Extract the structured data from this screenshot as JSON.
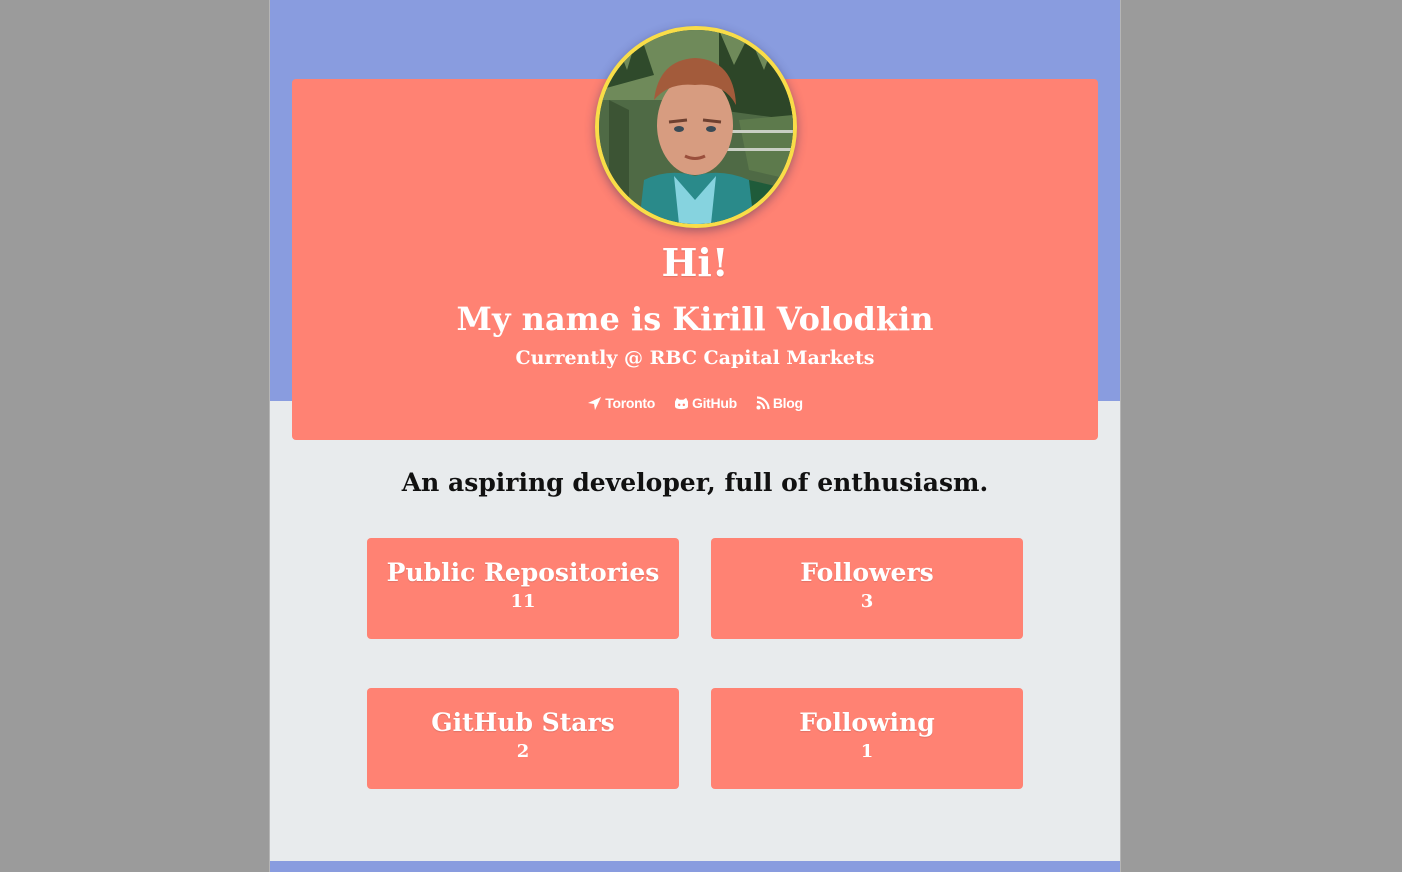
{
  "profile": {
    "greeting": "Hi!",
    "name_line": "My name is Kirill Volodkin",
    "subtitle": "Currently @ RBC Capital Markets",
    "avatar_icon": "profile-photo"
  },
  "links": [
    {
      "label": "Toronto",
      "icon": "location-arrow-icon"
    },
    {
      "label": "GitHub",
      "icon": "github-icon"
    },
    {
      "label": "Blog",
      "icon": "rss-icon"
    }
  ],
  "tagline": "An aspiring developer, full of enthusiasm.",
  "stats": [
    {
      "label": "Public Repositories",
      "value": "11"
    },
    {
      "label": "Followers",
      "value": "3"
    },
    {
      "label": "GitHub Stars",
      "value": "2"
    },
    {
      "label": "Following",
      "value": "1"
    }
  ],
  "colors": {
    "background": "#9b9b9b",
    "band": "#899cdf",
    "card": "#ff8273",
    "content_bg": "#e8ebed",
    "avatar_border": "#f9dd48"
  }
}
